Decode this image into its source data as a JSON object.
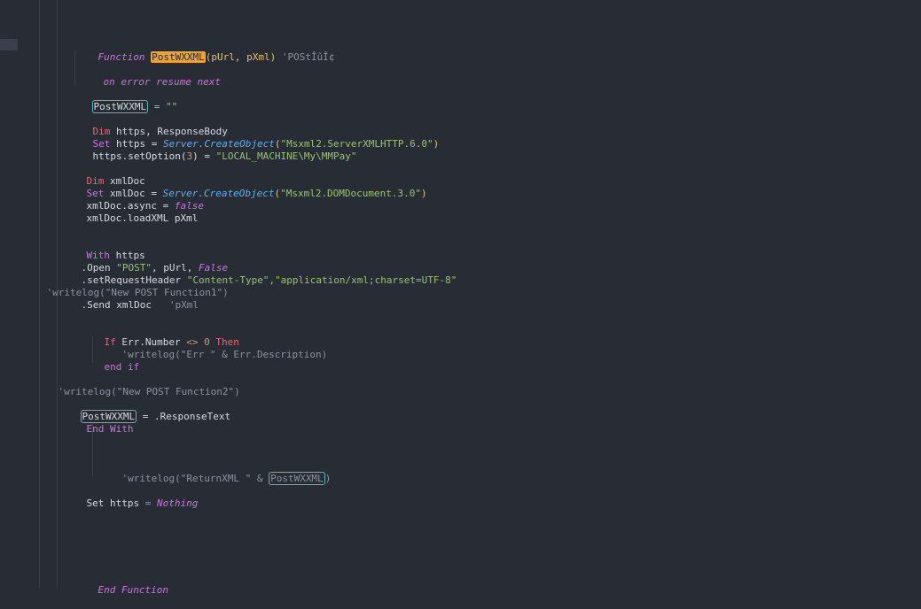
{
  "editor": {
    "language": "VBScript",
    "highlight_colors": {
      "selection_match": "#e8a33d",
      "occurrence_box": "#56b6c2"
    },
    "lines": {
      "l1_keyword": "Function",
      "l1_name": "PostWXXML",
      "l1_params": "(pUrl, pXml)",
      "l1_comment": " 'POStÎûÎ¢",
      "l2": "on error resume next",
      "l3_name": "PostWXXML",
      "l3_rest": " = \"\"",
      "l4_dim": "Dim",
      "l4_rest": " https, ResponseBody",
      "l5_set": "Set",
      "l5_var": " https = ",
      "l5_obj": "Server.",
      "l5_fn": "CreateObject",
      "l5_str": "\"Msxml2.ServerXMLHTTP.6.0\"",
      "l6_a": "https.setOption(",
      "l6_num": "3",
      "l6_b": ") = ",
      "l6_str": "\"LOCAL_MACHINE\\My\\MMPay\"",
      "l7_dim": "Dim",
      "l7_rest": " xmlDoc",
      "l8_set": "Set",
      "l8_var": " xmlDoc = ",
      "l8_obj": "Server.",
      "l8_fn": "CreateObject",
      "l8_str": "\"Msxml2.DOMDocument.3.0\"",
      "l9_a": "xmlDoc.async = ",
      "l9_val": "false",
      "l10": "xmlDoc.loadXML pXml",
      "l11_kw": "With",
      "l11_rest": " https",
      "l12_a": ".Open ",
      "l12_str": "\"POST\"",
      "l12_b": ", pUrl, ",
      "l12_val": "False",
      "l13_a": ".setRequestHeader ",
      "l13_str1": "\"Content-Type\"",
      "l13_str2": ",\"application/xml;charset=UTF-8\"",
      "l14": "'writelog(\"New POST Function1\")",
      "l15_a": ".Send xmlDoc",
      "l15_cmt": "   'pXml",
      "l16_if": "If",
      "l16_a": " Err.Number ",
      "l16_op": "<>",
      "l16_num": " 0",
      "l16_then": " Then",
      "l17": "'writelog(\"Err \" & Err.Description)",
      "l18": "end if",
      "l19": "'writelog(\"New POST Function2\")",
      "l20_name": "PostWXXML",
      "l20_rest": " = .ResponseText",
      "l21": "End With",
      "l22_a": "'writelog(\"ReturnXML \" & ",
      "l22_name": "PostWXXML",
      "l22_b": ")",
      "l23_a": "Set https ",
      "l23_op": "= ",
      "l23_val": "Nothing",
      "l24": "End Function"
    }
  }
}
